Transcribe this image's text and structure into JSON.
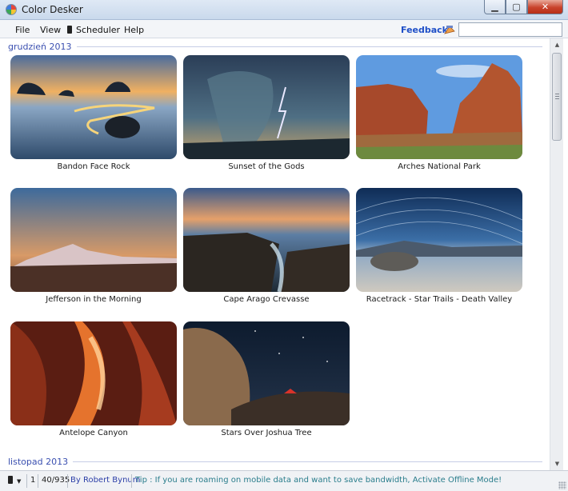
{
  "window": {
    "title": "Color Desker"
  },
  "menu": {
    "items": [
      "File",
      "View",
      "Scheduler",
      "Help"
    ],
    "feedback_label": "Feedback",
    "search_value": ""
  },
  "groups": [
    {
      "label": "grudzień 2013",
      "items": [
        {
          "caption": "Bandon Face Rock"
        },
        {
          "caption": "Sunset of the Gods"
        },
        {
          "caption": "Arches National Park"
        },
        {
          "caption": "Jefferson in the Morning"
        },
        {
          "caption": "Cape Arago Crevasse"
        },
        {
          "caption": "Racetrack - Star Trails - Death Valley"
        },
        {
          "caption": "Antelope Canyon"
        },
        {
          "caption": "Stars Over Joshua Tree"
        }
      ]
    },
    {
      "label": "listopad 2013",
      "items": []
    }
  ],
  "status": {
    "page": "1",
    "count": "40/935",
    "author": "By Robert Bynum",
    "tip": "Tip : If you are roaming on mobile data and want to save bandwidth, Activate Offline Mode!"
  },
  "colors": {
    "accent": "#1f4fc7",
    "group_header": "#3a4fb0",
    "tip": "#2a7d8c"
  }
}
